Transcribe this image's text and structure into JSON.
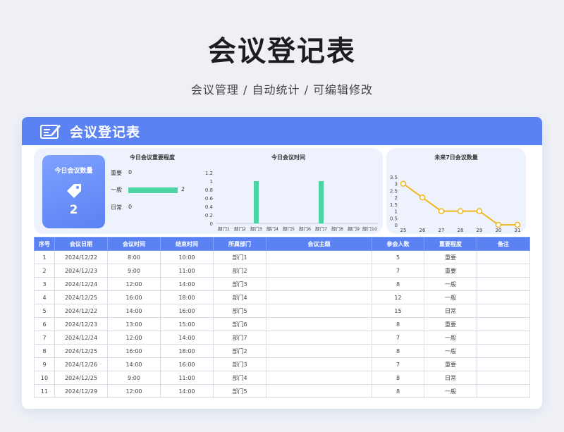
{
  "page": {
    "title": "会议登记表",
    "subtitle": "会议管理 / 自动统计 / 可编辑修改"
  },
  "card": {
    "title": "会议登记表",
    "accent_color": "#5b82f3",
    "icon": "meeting-register-icon"
  },
  "kpi": {
    "label": "今日会议数量",
    "icon": "tag-icon",
    "value": "2"
  },
  "chart_data": [
    {
      "type": "bar",
      "orientation": "horizontal",
      "title": "今日会议重要程度",
      "categories": [
        "重要",
        "一般",
        "日常"
      ],
      "values": [
        0,
        2,
        0
      ],
      "color": "#4cd4a4"
    },
    {
      "type": "bar",
      "title": "今日会议时间",
      "categories": [
        "部门1",
        "部门2",
        "部门3",
        "部门4",
        "部门5",
        "部门6",
        "部门7",
        "部门8",
        "部门9",
        "部门10"
      ],
      "values": [
        0,
        0,
        1,
        0,
        0,
        0,
        1,
        0,
        0,
        0
      ],
      "ylim": [
        0,
        1.2
      ],
      "yticks": [
        "0",
        "0.2",
        "0.4",
        "0.6",
        "0.8",
        "1",
        "1.2"
      ],
      "color": "#4cd4a4"
    },
    {
      "type": "line",
      "title": "未来7日会议数量",
      "x": [
        "25",
        "26",
        "27",
        "28",
        "29",
        "30",
        "31"
      ],
      "values": [
        3,
        2,
        1,
        1,
        1,
        0,
        0
      ],
      "ylim": [
        0,
        3.5
      ],
      "yticks": [
        "0",
        "0.5",
        "1",
        "1.5",
        "2",
        "2.5",
        "3",
        "3.5"
      ],
      "color": "#f0b81e"
    }
  ],
  "table": {
    "headers": [
      "序号",
      "会议日期",
      "会议时间",
      "结束时间",
      "所属部门",
      "会议主题",
      "参会人数",
      "重要程度",
      "备注"
    ],
    "rows": [
      [
        "1",
        "2024/12/22",
        "8:00",
        "10:00",
        "部门1",
        "",
        "5",
        "重要",
        ""
      ],
      [
        "2",
        "2024/12/23",
        "9:00",
        "11:00",
        "部门2",
        "",
        "7",
        "重要",
        ""
      ],
      [
        "3",
        "2024/12/24",
        "12:00",
        "14:00",
        "部门3",
        "",
        "8",
        "一般",
        ""
      ],
      [
        "4",
        "2024/12/25",
        "16:00",
        "18:00",
        "部门4",
        "",
        "12",
        "一般",
        ""
      ],
      [
        "5",
        "2024/12/22",
        "14:00",
        "16:00",
        "部门5",
        "",
        "15",
        "日常",
        ""
      ],
      [
        "6",
        "2024/12/23",
        "13:00",
        "15:00",
        "部门6",
        "",
        "8",
        "重要",
        ""
      ],
      [
        "7",
        "2024/12/24",
        "12:00",
        "14:00",
        "部门7",
        "",
        "7",
        "一般",
        ""
      ],
      [
        "8",
        "2024/12/25",
        "16:00",
        "18:00",
        "部门2",
        "",
        "8",
        "一般",
        ""
      ],
      [
        "9",
        "2024/12/26",
        "14:00",
        "16:00",
        "部门3",
        "",
        "7",
        "重要",
        ""
      ],
      [
        "10",
        "2024/12/25",
        "9:00",
        "11:00",
        "部门4",
        "",
        "8",
        "日常",
        ""
      ],
      [
        "11",
        "2024/12/29",
        "12:00",
        "14:00",
        "部门5",
        "",
        "8",
        "一般",
        ""
      ]
    ]
  }
}
